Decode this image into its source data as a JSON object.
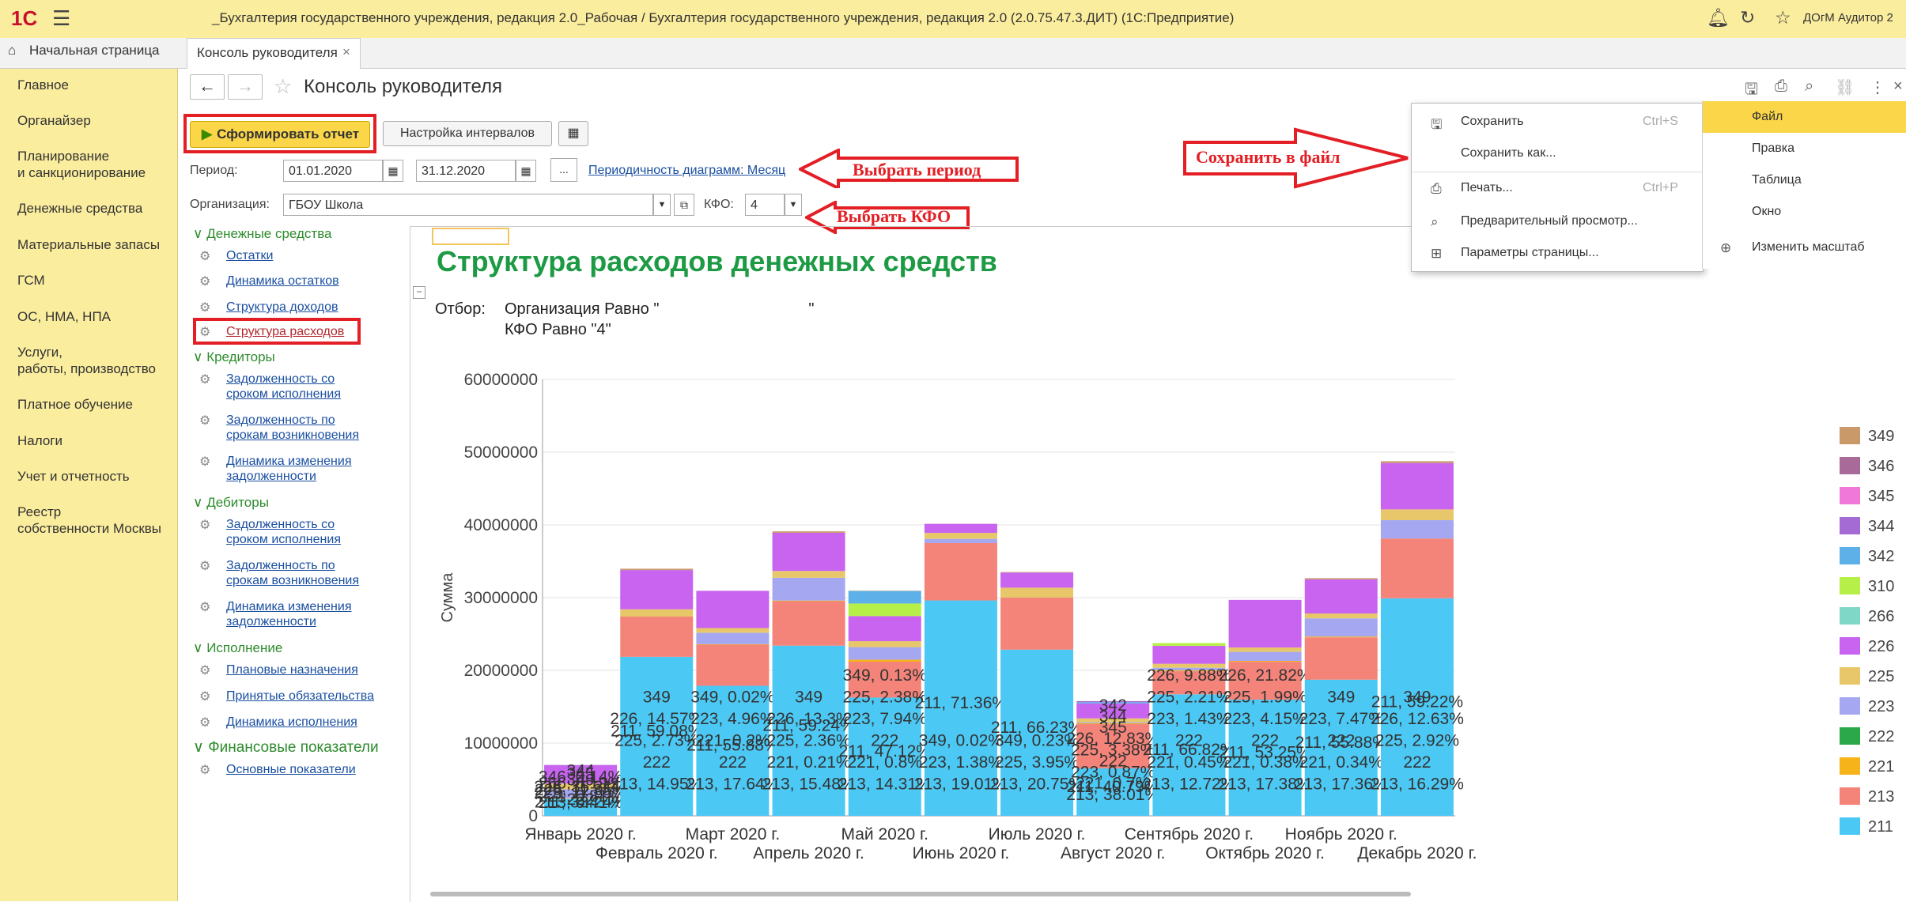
{
  "app": {
    "logo": "1С",
    "title": "_Бухгалтерия государственного учреждения, редакция 2.0_Рабочая / Бухгалтерия государственного учреждения, редакция 2.0 (2.0.75.47.3.ДИТ)  (1С:Предприятие)",
    "user": "ДОгМ Аудитор 2"
  },
  "tabs": {
    "home": "Начальная страница",
    "active": "Консоль руководителя"
  },
  "sidebar": {
    "items": [
      {
        "label": "Главное"
      },
      {
        "label": "Органайзер"
      },
      {
        "label": "Планирование\nи санкционирование"
      },
      {
        "label": "Денежные средства"
      },
      {
        "label": "Материальные запасы"
      },
      {
        "label": "ГСМ"
      },
      {
        "label": "ОС, НМА, НПА"
      },
      {
        "label": "Услуги,\nработы, производство"
      },
      {
        "label": "Платное обучение"
      },
      {
        "label": "Налоги"
      },
      {
        "label": "Учет и отчетность"
      },
      {
        "label": "Реестр\nсобственности Москвы"
      }
    ]
  },
  "page": {
    "title": "Консоль руководителя",
    "generate_label": "Сформировать отчет",
    "intervals_label": "Настройка интервалов",
    "period_label": "Период:",
    "date_from": "01.01.2020",
    "date_to": "31.12.2020",
    "dots": "...",
    "periodicity_link": "Периодичность диаграмм: Месяц",
    "org_label": "Организация:",
    "org_value": "ГБОУ Школа",
    "kfo_label": "КФО:",
    "kfo_value": "4"
  },
  "tree": {
    "groups": [
      {
        "title": "Денежные средства",
        "items": [
          "Остатки",
          "Динамика остатков",
          "Структура доходов",
          "Структура расходов"
        ]
      },
      {
        "title": "Кредиторы",
        "items": [
          "Задолженность со\nсроком исполнения",
          "Задолженность по\nсрокам возникновения",
          "Динамика изменения\nзадолженности"
        ]
      },
      {
        "title": "Дебиторы",
        "items": [
          "Задолженность со\nсроком исполнения",
          "Задолженность по\nсрокам возникновения",
          "Динамика изменения\nзадолженности"
        ]
      },
      {
        "title": "Исполнение",
        "items": [
          "Плановые назначения",
          "Принятые обязательства",
          "Динамика исполнения"
        ]
      },
      {
        "title": "Финансовые показатели",
        "items": [
          "Основные показатели"
        ]
      }
    ]
  },
  "report": {
    "title": "Структура расходов денежных средств",
    "otbor_label": "Отбор:",
    "otbor_line1": "Организация Равно \"                                  \"",
    "otbor_line2": "КФО Равно \"4\""
  },
  "context_menu": {
    "items": [
      {
        "label": "Сохранить",
        "shortcut": "Ctrl+S",
        "icon": "save-icon"
      },
      {
        "label": "Сохранить как...",
        "shortcut": "",
        "icon": ""
      },
      {
        "label": "Печать...",
        "shortcut": "Ctrl+P",
        "icon": "print-icon"
      },
      {
        "label": "Предварительный просмотр...",
        "shortcut": "",
        "icon": "preview-icon"
      },
      {
        "label": "Параметры страницы...",
        "shortcut": "",
        "icon": "page-setup-icon"
      }
    ],
    "right_items": [
      "Файл",
      "Правка",
      "Таблица",
      "Окно",
      "Изменить масштаб"
    ]
  },
  "callouts": {
    "period": "Выбрать период",
    "kfo": "Выбрать КФО",
    "save": "Сохранить в файл"
  },
  "chart_data": {
    "type": "bar",
    "stacked": true,
    "ylabel": "Сумма",
    "ylim": [
      0,
      60000000
    ],
    "yticks": [
      0,
      10000000,
      20000000,
      30000000,
      40000000,
      50000000,
      60000000
    ],
    "ytick_labels": [
      "0",
      "10000000",
      "20000000",
      "30000000",
      "40000000",
      "50000000",
      "60000000"
    ],
    "grid": true,
    "legend_position": "right",
    "categories": [
      "Январь 2020 г.",
      "Февраль 2020 г.",
      "Март 2020 г.",
      "Апрель 2020 г.",
      "Май 2020 г.",
      "Июнь 2020 г.",
      "Июль 2020 г.",
      "Август 2020 г.",
      "Сентябрь 2020 г.",
      "Октябрь 2020 г.",
      "Ноябрь 2020 г.",
      "Декабрь 2020 г."
    ],
    "totals": [
      7000000,
      37000000,
      32000000,
      39500000,
      34500000,
      41500000,
      34500000,
      16000000,
      25000000,
      30000000,
      33500000,
      50500000
    ],
    "series": [
      {
        "name": "211",
        "color": "#4cc8f4",
        "pct": [
          33.24,
          59.08,
          55.88,
          59.24,
          47.12,
          71.36,
          66.23,
          40.79,
          66.82,
          53.25,
          55.88,
          59.22
        ]
      },
      {
        "name": "213",
        "color": "#f4837a",
        "pct": [
          0.41,
          14.95,
          17.64,
          15.48,
          14.31,
          19.01,
          20.75,
          38.01,
          12.72,
          17.38,
          17.36,
          16.29
        ]
      },
      {
        "name": "221",
        "color": "#f6b31a",
        "pct": [
          0.81,
          0,
          0.2,
          0.21,
          0.8,
          0,
          0,
          0.7,
          0.45,
          0.38,
          0.34,
          0
        ]
      },
      {
        "name": "222",
        "color": "#2aa84a",
        "pct": [
          0,
          0,
          0,
          0,
          0,
          0,
          0,
          0,
          0,
          0,
          0,
          0
        ]
      },
      {
        "name": "223",
        "color": "#a5a8f0",
        "pct": [
          17.55,
          0,
          4.96,
          7.94,
          5,
          1.38,
          0,
          0.87,
          1.43,
          4.15,
          7.47,
          5
        ]
      },
      {
        "name": "225",
        "color": "#e8c66a",
        "pct": [
          11.35,
          2.73,
          2,
          2.36,
          2.38,
          2,
          3.95,
          3.38,
          2.21,
          1.99,
          2,
          2.92
        ]
      },
      {
        "name": "226",
        "color": "#c864f0",
        "pct": [
          36.31,
          14.57,
          16,
          13.3,
          10,
          3,
          6,
          12.83,
          9.88,
          21.82,
          14,
          12.63
        ]
      },
      {
        "name": "266",
        "color": "#7fd7c8",
        "pct": [
          0.19,
          0,
          0,
          0,
          0,
          0,
          0,
          0,
          0,
          0,
          0,
          0
        ]
      },
      {
        "name": "310",
        "color": "#b6ef48",
        "pct": [
          0,
          0,
          0,
          0,
          5,
          0,
          0,
          0,
          1.5,
          0,
          0,
          0
        ]
      },
      {
        "name": "342",
        "color": "#5eb1e8",
        "pct": [
          0,
          0,
          0,
          0,
          5,
          0,
          0,
          1,
          0,
          0,
          0,
          0
        ]
      },
      {
        "name": "344",
        "color": "#a56bd4",
        "pct": [
          0.14,
          0,
          0,
          0,
          0,
          0,
          0,
          1,
          0,
          0,
          0,
          0
        ]
      },
      {
        "name": "345",
        "color": "#f078d8",
        "pct": [
          0,
          0,
          0,
          0,
          0,
          0,
          0,
          0,
          0,
          0,
          0,
          0
        ]
      },
      {
        "name": "346",
        "color": "#a86a98",
        "pct": [
          0.14,
          0,
          0,
          0,
          0,
          0,
          0,
          0,
          0,
          0,
          0,
          0
        ]
      },
      {
        "name": "349",
        "color": "#c9996a",
        "pct": [
          0,
          0.5,
          0.02,
          0.5,
          0.13,
          0.02,
          0.23,
          0,
          0,
          0,
          0.5,
          0.5
        ]
      }
    ],
    "labels": [
      [
        "344",
        "345",
        "346, 0.14%",
        "349",
        "266, 0.19%",
        "226, 36.31%",
        "225, 11.35%",
        "223, 17.55%",
        "221, 0.81%",
        "222",
        "213, 0.41%",
        "211, 33.24%"
      ],
      [
        "349",
        "226, 14.57%",
        "225, 2.73%",
        "222",
        "213, 14.95%",
        "211, 59.08%"
      ],
      [
        "349, 0.02%",
        "223, 4.96%",
        "221, 0.2%",
        "222",
        "213, 17.64%",
        "211, 55.88%"
      ],
      [
        "349",
        "226, 13.3%",
        "225, 2.36%",
        "221, 0.21%",
        "213, 15.48%",
        "211, 59.24%"
      ],
      [
        "349, 0.13%",
        "225, 2.38%",
        "223, 7.94%",
        "222",
        "221, 0.8%",
        "213, 14.31%",
        "211, 47.12%"
      ],
      [
        "349, 0.02%",
        "223, 1.38%",
        "213, 19.01%",
        "211, 71.36%"
      ],
      [
        "349, 0.23%",
        "225, 3.95%",
        "213, 20.75%",
        "211, 66.23%"
      ],
      [
        "342",
        "344",
        "345",
        "226, 12.83%",
        "225, 3.38%",
        "222",
        "223, 0.87%",
        "221, 0.7%",
        "213, 38.01%",
        "211, 40.79%"
      ],
      [
        "226, 9.88%",
        "225, 2.21%",
        "223, 1.43%",
        "222",
        "221, 0.45%",
        "213, 12.72%",
        "211, 66.82%"
      ],
      [
        "226, 21.82%",
        "225, 1.99%",
        "223, 4.15%",
        "222",
        "221, 0.38%",
        "213, 17.38%",
        "211, 53.25%"
      ],
      [
        "349",
        "223, 7.47%",
        "222",
        "221, 0.34%",
        "213, 17.36%",
        "211, 55.88%"
      ],
      [
        "349",
        "226, 12.63%",
        "225, 2.92%",
        "222",
        "213, 16.29%",
        "211, 59.22%"
      ]
    ],
    "legend": [
      "349",
      "346",
      "345",
      "344",
      "342",
      "310",
      "266",
      "226",
      "225",
      "223",
      "222",
      "221",
      "213",
      "211"
    ]
  }
}
